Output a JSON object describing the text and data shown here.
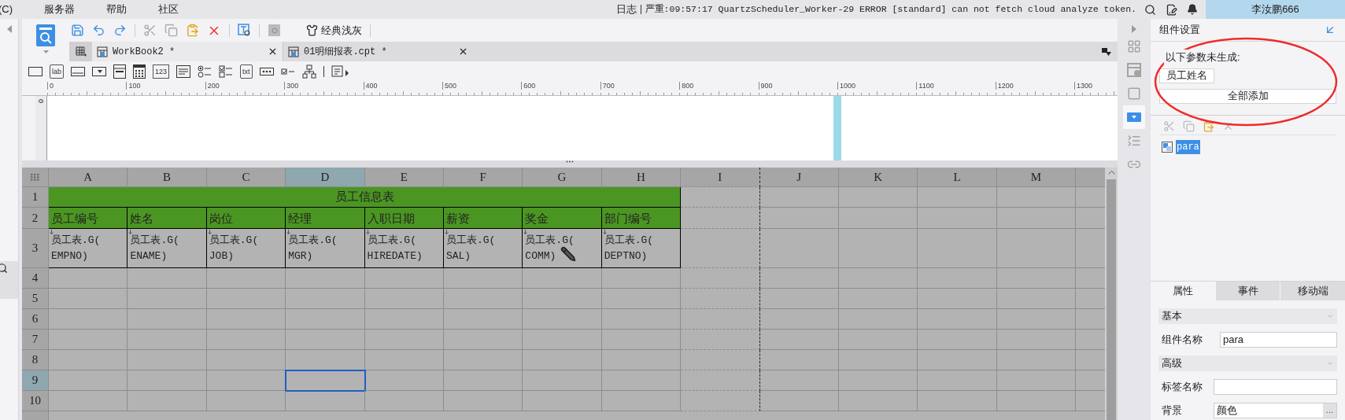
{
  "menu_bar": {
    "items": [
      {
        "label": "(C)"
      },
      {
        "label": "服务器"
      },
      {
        "label": "帮助"
      },
      {
        "label": "社区"
      }
    ],
    "log_label": "日志",
    "log_message": "严重:09:57:17 QuartzScheduler_Worker-29 ERROR [standard] can not fetch cloud analyze token.",
    "user": "李汝鹏666"
  },
  "toolbar": {
    "theme_button": "经典浅灰"
  },
  "tabs": [
    {
      "label": "WorkBook2 *",
      "selected": true
    },
    {
      "label": "01明细报表.cpt *",
      "selected": false
    }
  ],
  "widgets": [
    {
      "kind": "button"
    },
    {
      "kind": "label",
      "text": "lab"
    },
    {
      "kind": "textbox"
    },
    {
      "kind": "combo"
    },
    {
      "kind": "date"
    },
    {
      "kind": "calendar"
    },
    {
      "kind": "number",
      "text": "123"
    },
    {
      "kind": "textarea"
    },
    {
      "kind": "radio"
    },
    {
      "kind": "checkgroup"
    },
    {
      "kind": "label",
      "text": "txt"
    },
    {
      "kind": "password"
    },
    {
      "kind": "checkbox"
    },
    {
      "kind": "tree"
    }
  ],
  "ruler": {
    "ticks": [
      "0",
      "100",
      "200",
      "300",
      "400",
      "500",
      "600",
      "700",
      "800",
      "900",
      "1000",
      "1100",
      "1200",
      "1300"
    ],
    "vertical_ticks": [
      "0"
    ]
  },
  "sheet": {
    "columns": [
      {
        "label": "A",
        "selected": false,
        "page_break": false
      },
      {
        "label": "B",
        "selected": false,
        "page_break": false
      },
      {
        "label": "C",
        "selected": false,
        "page_break": false
      },
      {
        "label": "D",
        "selected": true,
        "page_break": false
      },
      {
        "label": "E",
        "selected": false,
        "page_break": false
      },
      {
        "label": "F",
        "selected": false,
        "page_break": false
      },
      {
        "label": "G",
        "selected": false,
        "page_break": false
      },
      {
        "label": "H",
        "selected": false,
        "page_break": false
      },
      {
        "label": "I",
        "selected": false,
        "page_break": true
      },
      {
        "label": "J",
        "selected": false,
        "page_break": false
      },
      {
        "label": "K",
        "selected": false,
        "page_break": false
      },
      {
        "label": "L",
        "selected": false,
        "page_break": false
      },
      {
        "label": "M",
        "selected": false,
        "page_break": false
      }
    ],
    "title": "员工信息表",
    "headers": [
      "员工编号",
      "姓名",
      "岗位",
      "经理",
      "入职日期",
      "薪资",
      "奖金",
      "部门编号"
    ],
    "formulas": [
      {
        "lines": [
          "员工表.G(",
          "EMPNO)"
        ]
      },
      {
        "lines": [
          "员工表.G(",
          "ENAME)"
        ]
      },
      {
        "lines": [
          "员工表.G(",
          "JOB)"
        ]
      },
      {
        "lines": [
          "员工表.G(",
          "MGR)"
        ]
      },
      {
        "lines": [
          "员工表.G(",
          "HIREDATE)"
        ]
      },
      {
        "lines": [
          "员工表.G(",
          "SAL)"
        ]
      },
      {
        "lines": [
          "员工表.G(",
          "COMM)"
        ]
      },
      {
        "lines": [
          "员工表.G(",
          "DEPTNO)"
        ]
      }
    ],
    "rows": [
      {
        "label": "1",
        "selected": false
      },
      {
        "label": "2",
        "selected": false
      },
      {
        "label": "3",
        "selected": false
      },
      {
        "label": "4",
        "selected": false
      },
      {
        "label": "5",
        "selected": false
      },
      {
        "label": "6",
        "selected": false
      },
      {
        "label": "7",
        "selected": false
      },
      {
        "label": "8",
        "selected": false
      },
      {
        "label": "9",
        "selected": true
      },
      {
        "label": "10",
        "selected": false
      }
    ]
  },
  "side_icons": [
    {
      "kind": "layout",
      "selected": false
    },
    {
      "kind": "info",
      "selected": false
    },
    {
      "kind": "frame",
      "selected": false
    },
    {
      "kind": "dropdown",
      "selected": true
    },
    {
      "kind": "list",
      "selected": false
    },
    {
      "kind": "link",
      "selected": false
    }
  ],
  "panel": {
    "title": "组件设置",
    "notice": "以下参数未生成:",
    "params": [
      "员工姓名"
    ],
    "add_all": "全部添加",
    "tree": [
      {
        "label": "para",
        "selected": true
      }
    ],
    "prop_tabs": [
      {
        "label": "属性",
        "selected": true
      },
      {
        "label": "事件",
        "selected": false
      },
      {
        "label": "移动端",
        "selected": false
      }
    ],
    "sections": [
      {
        "title": "基本",
        "fields": [
          {
            "label": "组件名称",
            "value": "para"
          }
        ]
      },
      {
        "title": "高级",
        "fields": [
          {
            "label": "标签名称"
          },
          {
            "label": "背景",
            "value": "颜色",
            "button": "..."
          }
        ]
      }
    ]
  }
}
